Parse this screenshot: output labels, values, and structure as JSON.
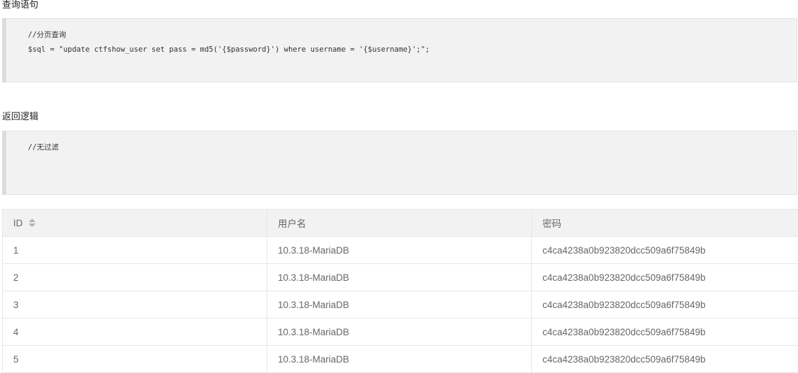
{
  "query_section": {
    "title": "查询语句",
    "code_lines": [
      "//分页查询",
      "$sql = \"update ctfshow_user set pass = md5('{$password}') where username = '{$username}';\";"
    ]
  },
  "return_section": {
    "title": "返回逻辑",
    "code_lines": [
      "//无过滤"
    ]
  },
  "table": {
    "headers": {
      "id": "ID",
      "username": "用户名",
      "password": "密码"
    },
    "rows": [
      {
        "id": "1",
        "username": "10.3.18-MariaDB",
        "password": "c4ca4238a0b923820dcc509a6f75849b"
      },
      {
        "id": "2",
        "username": "10.3.18-MariaDB",
        "password": "c4ca4238a0b923820dcc509a6f75849b"
      },
      {
        "id": "3",
        "username": "10.3.18-MariaDB",
        "password": "c4ca4238a0b923820dcc509a6f75849b"
      },
      {
        "id": "4",
        "username": "10.3.18-MariaDB",
        "password": "c4ca4238a0b923820dcc509a6f75849b"
      },
      {
        "id": "5",
        "username": "10.3.18-MariaDB",
        "password": "c4ca4238a0b923820dcc509a6f75849b"
      }
    ]
  }
}
